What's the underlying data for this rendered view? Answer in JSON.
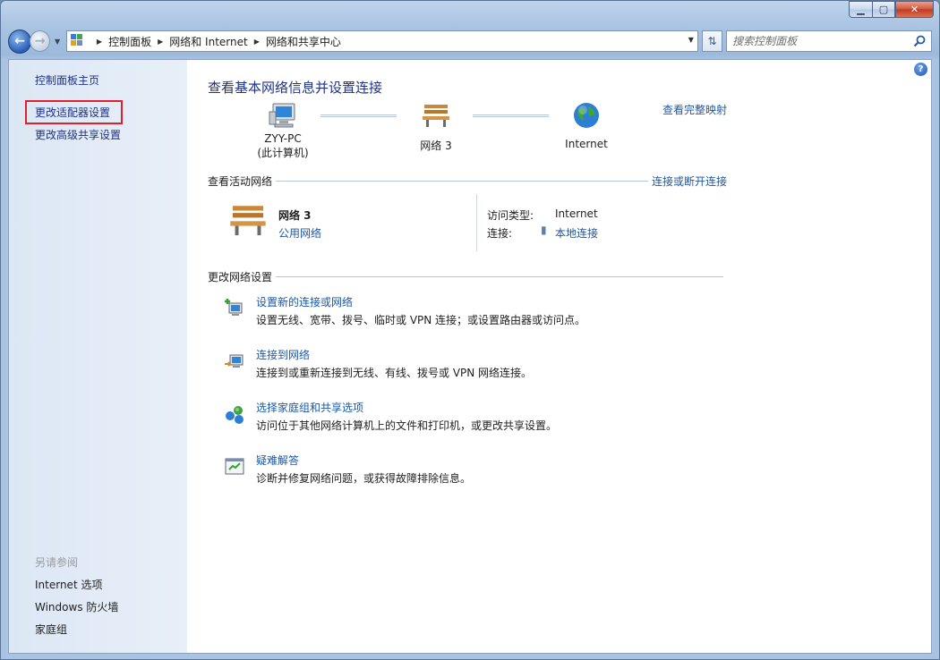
{
  "window": {
    "caption": {
      "minimize": "▁",
      "maximize": "▢",
      "close": "✕"
    }
  },
  "addressbar": {
    "crumbs": [
      "控制面板",
      "网络和 Internet",
      "网络和共享中心"
    ],
    "search_placeholder": "搜索控制面板"
  },
  "sidebar": {
    "home": "控制面板主页",
    "links": [
      "更改适配器设置",
      "更改高级共享设置"
    ],
    "see_also_heading": "另请参阅",
    "see_also": [
      "Internet 选项",
      "Windows 防火墙",
      "家庭组"
    ]
  },
  "main": {
    "title": "查看基本网络信息并设置连接",
    "full_map": "查看完整映射",
    "map": {
      "computer_name": "ZYY-PC",
      "computer_sub": "(此计算机)",
      "network": "网络  3",
      "internet": "Internet"
    },
    "active_networks": {
      "label": "查看活动网络",
      "connect_link": "连接或断开连接",
      "network_name": "网络  3",
      "network_type": "公用网络",
      "access_label": "访问类型:",
      "access_value": "Internet",
      "conn_label": "连接:",
      "conn_value": "本地连接"
    },
    "change_settings": {
      "label": "更改网络设置",
      "tasks": [
        {
          "title": "设置新的连接或网络",
          "desc": "设置无线、宽带、拨号、临时或 VPN 连接；或设置路由器或访问点。",
          "icon": "new-connection-icon"
        },
        {
          "title": "连接到网络",
          "desc": "连接到或重新连接到无线、有线、拨号或 VPN 网络连接。",
          "icon": "connect-network-icon"
        },
        {
          "title": "选择家庭组和共享选项",
          "desc": "访问位于其他网络计算机上的文件和打印机，或更改共享设置。",
          "icon": "homegroup-icon"
        },
        {
          "title": "疑难解答",
          "desc": "诊断并修复网络问题，或获得故障排除信息。",
          "icon": "troubleshoot-icon"
        }
      ]
    }
  }
}
